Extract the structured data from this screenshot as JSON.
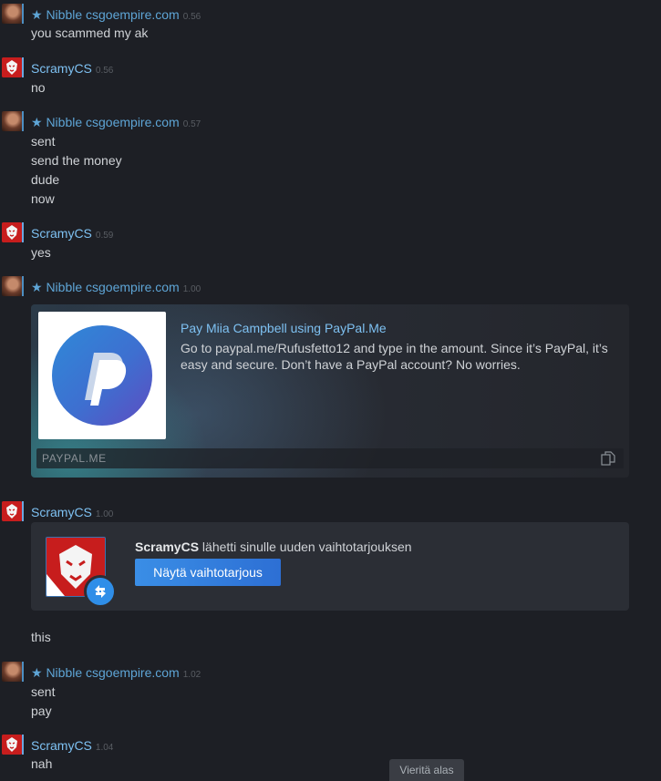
{
  "messages": {
    "m1": {
      "author": "★ Nibble csgoempire.com",
      "time": "0.56",
      "lines": [
        "you scammed my ak"
      ]
    },
    "m2": {
      "author": "ScramyCS",
      "time": "0.56",
      "lines": [
        "no"
      ]
    },
    "m3": {
      "author": "★ Nibble csgoempire.com",
      "time": "0.57",
      "lines": [
        "sent",
        "send the money",
        "dude",
        "now"
      ]
    },
    "m4": {
      "author": "ScramyCS",
      "time": "0.59",
      "lines": [
        "yes"
      ]
    },
    "m5": {
      "author": "★ Nibble csgoempire.com",
      "time": "1.00"
    },
    "m6": {
      "author": "ScramyCS",
      "time": "1.00",
      "after": "this"
    },
    "m7": {
      "author": "★ Nibble csgoempire.com",
      "time": "1.02",
      "lines": [
        "sent",
        "pay"
      ]
    },
    "m8": {
      "author": "ScramyCS",
      "time": "1.04",
      "lines": [
        "nah"
      ]
    }
  },
  "embed": {
    "title": "Pay Miia Campbell using PayPal.Me",
    "description": "Go to paypal.me/Rufusfetto12 and type in the amount. Since it’s PayPal, it’s easy and secure. Don’t have a PayPal account? No worries.",
    "domain": "PAYPAL.ME",
    "thumb_icon": "paypal-logo",
    "copy_icon": "copy-icon"
  },
  "trade_offer": {
    "sender": "ScramyCS",
    "text": " lähetti sinulle uuden vaihtotarjouksen",
    "button_label": "Näytä vaihtotarjous",
    "badge_icon": "trade-arrows-icon"
  },
  "scroll_button": {
    "label": "Vieritä alas"
  },
  "colors": {
    "background": "#1d1f25",
    "nibble_name": "#5ea5d6",
    "scramy_name": "#7ec1f2",
    "button": "#2d6fd4",
    "text": "#cfd2d6"
  }
}
